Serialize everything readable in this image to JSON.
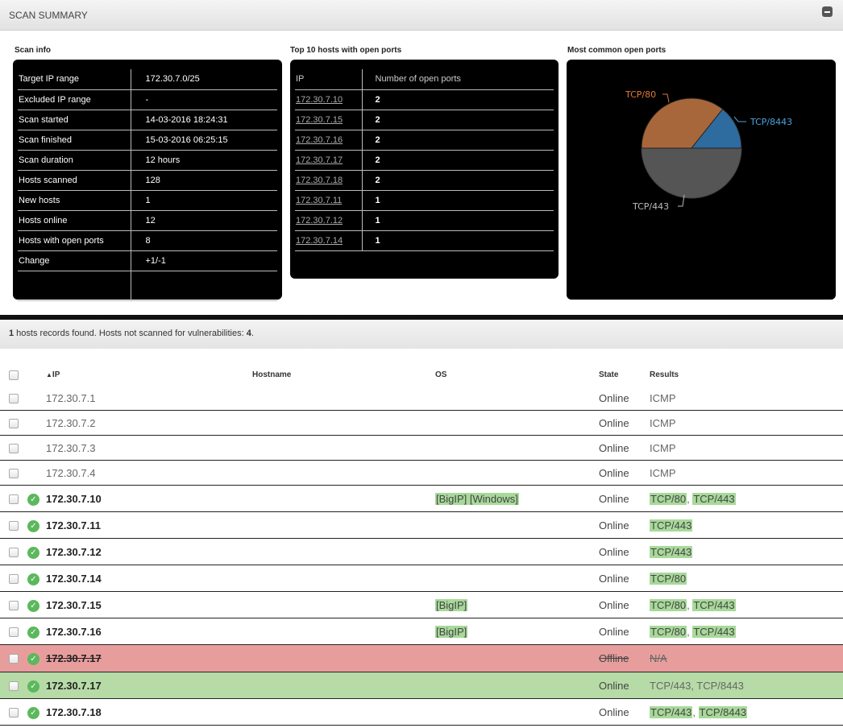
{
  "header": {
    "title": "SCAN SUMMARY"
  },
  "scan_info": {
    "label": "Scan info",
    "rows": [
      {
        "key": "Target IP range",
        "value": "172.30.7.0/25"
      },
      {
        "key": "Excluded IP range",
        "value": "-"
      },
      {
        "key": "Scan started",
        "value": "14-03-2016 18:24:31"
      },
      {
        "key": "Scan finished",
        "value": "15-03-2016 06:25:15"
      },
      {
        "key": "Scan duration",
        "value": "12 hours"
      },
      {
        "key": "Hosts scanned",
        "value": "128"
      },
      {
        "key": "New hosts",
        "value": "1"
      },
      {
        "key": "Hosts online",
        "value": "12"
      },
      {
        "key": "Hosts with open ports",
        "value": "8"
      },
      {
        "key": "Change",
        "value": "+1/-1"
      },
      {
        "key": "",
        "value": ""
      }
    ]
  },
  "top_hosts": {
    "label": "Top 10 hosts with open ports",
    "col_ip": "IP",
    "col_count": "Number of open ports",
    "rows": [
      {
        "ip": "172.30.7.10",
        "count": "2"
      },
      {
        "ip": "172.30.7.15",
        "count": "2"
      },
      {
        "ip": "172.30.7.16",
        "count": "2"
      },
      {
        "ip": "172.30.7.17",
        "count": "2"
      },
      {
        "ip": "172.30.7.18",
        "count": "2"
      },
      {
        "ip": "172.30.7.11",
        "count": "1"
      },
      {
        "ip": "172.30.7.12",
        "count": "1"
      },
      {
        "ip": "172.30.7.14",
        "count": "1"
      }
    ]
  },
  "common_ports": {
    "label": "Most common open ports",
    "chart_data": {
      "type": "pie",
      "series": [
        {
          "name": "TCP/443",
          "value": 7,
          "color": "#555555"
        },
        {
          "name": "TCP/80",
          "value": 5,
          "color": "#a8673a"
        },
        {
          "name": "TCP/8443",
          "value": 2,
          "color": "#2e6b9f"
        }
      ],
      "label_colors": {
        "TCP/80": "#e07a34",
        "TCP/8443": "#4aa3df",
        "TCP/443": "#bbbbbb"
      }
    }
  },
  "records": {
    "count": "1",
    "text_before": " hosts records found. Hosts not scanned for vulnerabilities: ",
    "not_scanned": "4",
    "text_after": "."
  },
  "grid": {
    "headers": {
      "ip": "IP",
      "hostname": "Hostname",
      "os": "OS",
      "state": "State",
      "results": "Results"
    },
    "rows": [
      {
        "ip": "172.30.7.1",
        "os": "",
        "state": "Online",
        "results": "ICMP"
      },
      {
        "ip": "172.30.7.2",
        "os": "",
        "state": "Online",
        "results": "ICMP"
      },
      {
        "ip": "172.30.7.3",
        "os": "",
        "state": "Online",
        "results": "ICMP"
      },
      {
        "ip": "172.30.7.4",
        "os": "",
        "state": "Online",
        "results": "ICMP"
      },
      {
        "ip": "172.30.7.10",
        "os": "[BigIP] [Windows]",
        "state": "Online",
        "results": [
          "TCP/80",
          "TCP/443"
        ]
      },
      {
        "ip": "172.30.7.11",
        "os": "",
        "state": "Online",
        "results": [
          "TCP/443"
        ]
      },
      {
        "ip": "172.30.7.12",
        "os": "",
        "state": "Online",
        "results": [
          "TCP/443"
        ]
      },
      {
        "ip": "172.30.7.14",
        "os": "",
        "state": "Online",
        "results": [
          "TCP/80"
        ]
      },
      {
        "ip": "172.30.7.15",
        "os": "[BigIP]",
        "state": "Online",
        "results": [
          "TCP/80",
          "TCP/443"
        ]
      },
      {
        "ip": "172.30.7.16",
        "os": "[BigIP]",
        "state": "Online",
        "results": [
          "TCP/80",
          "TCP/443"
        ]
      },
      {
        "ip": "172.30.7.17",
        "os": "",
        "state": "Offline",
        "results": "N/A"
      },
      {
        "ip": "172.30.7.17",
        "os": "",
        "state": "Online",
        "results": "TCP/443, TCP/8443"
      },
      {
        "ip": "172.30.7.18",
        "os": "",
        "state": "Online",
        "results": [
          "TCP/443",
          "TCP/8443"
        ]
      }
    ]
  }
}
